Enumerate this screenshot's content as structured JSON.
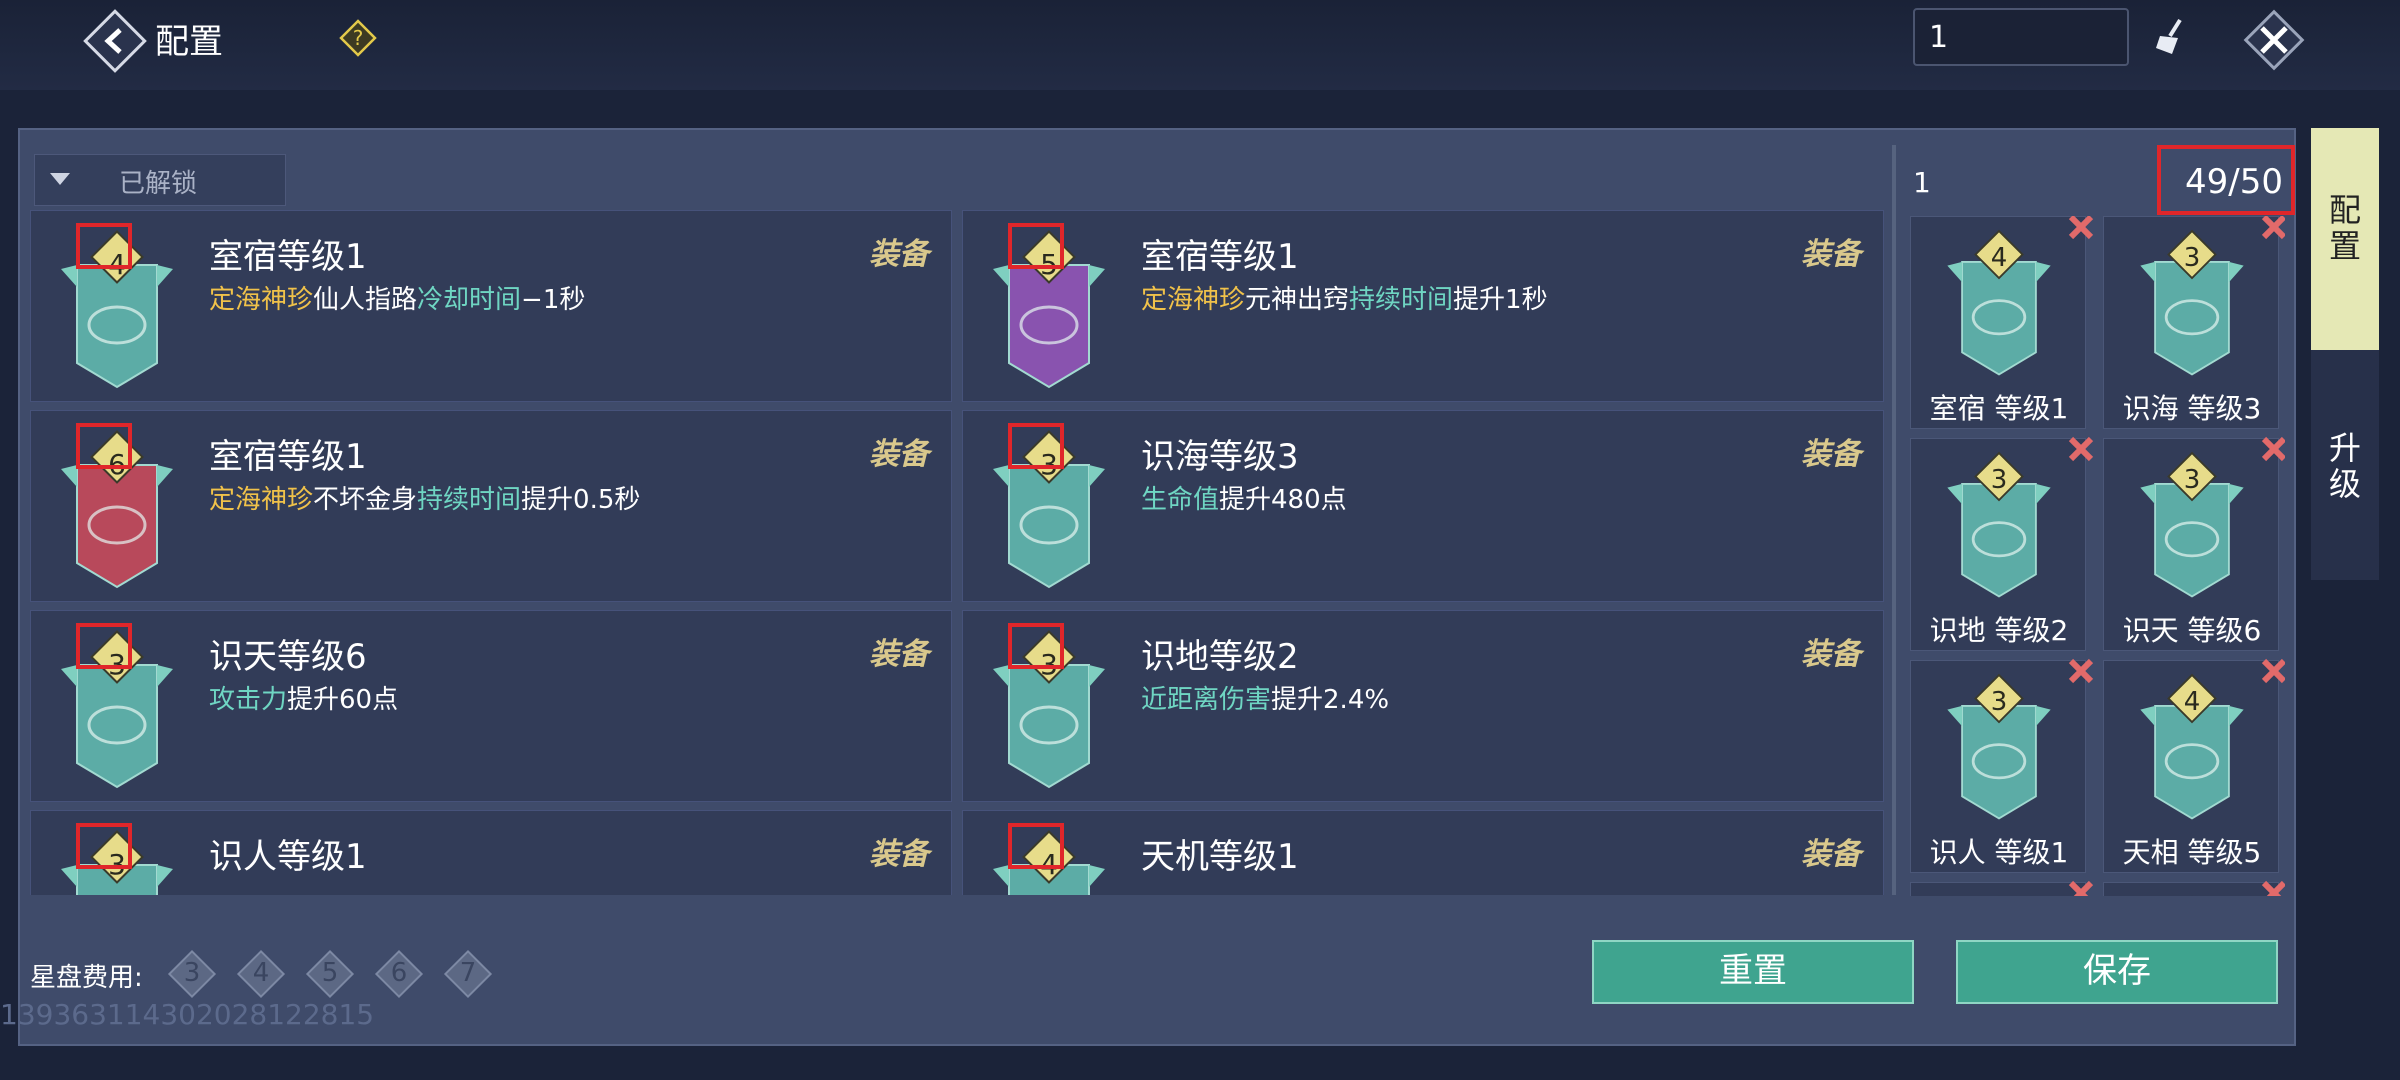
{
  "header": {
    "title": "配置",
    "page_input_value": "1"
  },
  "filter": {
    "label": "已解锁"
  },
  "cards": [
    {
      "name": "室宿等级1",
      "level": "4",
      "color": "teal",
      "equip": "装备",
      "desc": [
        {
          "t": "定海神珍",
          "c": "y"
        },
        {
          "t": "仙人指路",
          "c": "w"
        },
        {
          "t": "冷却时间",
          "c": "g"
        },
        {
          "t": "−1秒",
          "c": "w"
        }
      ]
    },
    {
      "name": "室宿等级1",
      "level": "5",
      "color": "purple",
      "equip": "装备",
      "desc": [
        {
          "t": "定海神珍",
          "c": "y"
        },
        {
          "t": "元神出窍",
          "c": "w"
        },
        {
          "t": "持续时间",
          "c": "g"
        },
        {
          "t": "提升1秒",
          "c": "w"
        }
      ]
    },
    {
      "name": "室宿等级1",
      "level": "6",
      "color": "red",
      "equip": "装备",
      "desc": [
        {
          "t": "定海神珍",
          "c": "y"
        },
        {
          "t": "不坏金身",
          "c": "w"
        },
        {
          "t": "持续时间",
          "c": "g"
        },
        {
          "t": "提升0.5秒",
          "c": "w"
        }
      ]
    },
    {
      "name": "识海等级3",
      "level": "3",
      "color": "teal",
      "equip": "装备",
      "desc": [
        {
          "t": "生命值",
          "c": "g"
        },
        {
          "t": "提升480点",
          "c": "w"
        }
      ]
    },
    {
      "name": "识天等级6",
      "level": "3",
      "color": "teal",
      "equip": "装备",
      "desc": [
        {
          "t": "攻击力",
          "c": "g"
        },
        {
          "t": "提升60点",
          "c": "w"
        }
      ]
    },
    {
      "name": "识地等级2",
      "level": "3",
      "color": "teal",
      "equip": "装备",
      "desc": [
        {
          "t": "近距离伤害",
          "c": "g"
        },
        {
          "t": "提升2.4%",
          "c": "w"
        }
      ]
    },
    {
      "name": "识人等级1",
      "level": "3",
      "color": "teal",
      "equip": "装备",
      "desc": []
    },
    {
      "name": "天机等级1",
      "level": "4",
      "color": "teal",
      "equip": "装备",
      "desc": []
    }
  ],
  "loadout": {
    "title": "1",
    "capacity": "49/50",
    "slots": [
      {
        "label": "室宿 等级1",
        "level": "4"
      },
      {
        "label": "识海 等级3",
        "level": "3"
      },
      {
        "label": "识地 等级2",
        "level": "3"
      },
      {
        "label": "识天 等级6",
        "level": "3"
      },
      {
        "label": "识人 等级1",
        "level": "3"
      },
      {
        "label": "天相 等级5",
        "level": "4"
      },
      {
        "label": "",
        "level": ""
      },
      {
        "label": "",
        "level": ""
      }
    ]
  },
  "side_tabs": {
    "config": "配置",
    "upgrade": "升级"
  },
  "footer": {
    "cost_label": "星盘费用:",
    "costs": [
      "3",
      "4",
      "5",
      "6",
      "7"
    ],
    "reset": "重置",
    "save": "保存",
    "uid": "1393631143020281228​15"
  },
  "colors": {
    "teal": "#5fb3ab",
    "purple": "#8e55b4",
    "red": "#c04a5c",
    "gold": "#e7dc8a",
    "accent": "#3fa48f"
  }
}
